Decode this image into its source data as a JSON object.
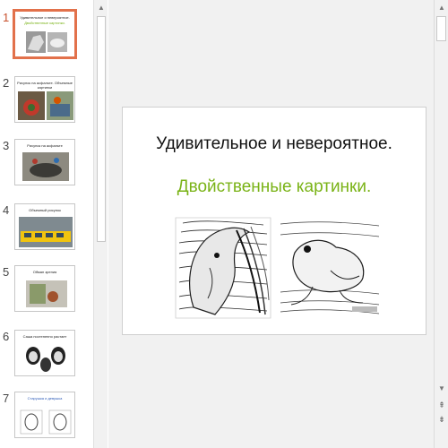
{
  "thumbnails": [
    {
      "number": "1",
      "title": "Удивительное и невероятное.",
      "subtitle": "Двойственные картинки."
    },
    {
      "number": "2",
      "title": "Рисунок на асфальте. Объемные картинки"
    },
    {
      "number": "3",
      "title": "Рисунок на асфальте"
    },
    {
      "number": "4",
      "title": "Объемный рисунок"
    },
    {
      "number": "5",
      "title": "Обман зрения"
    },
    {
      "number": "6",
      "title": "Саша постепенно растает"
    },
    {
      "number": "7",
      "title": "Старушка и девушка"
    }
  ],
  "slide": {
    "title": "Удивительное и невероятное.",
    "subtitle": "Двойственные картинки."
  },
  "icons": {
    "scroll_up": "up-arrow-icon",
    "scroll_down": "down-arrow-icon",
    "prev_slide": "double-up-arrow-icon",
    "next_slide": "double-down-arrow-icon"
  },
  "colors": {
    "active_thumb_border": "#e2714b",
    "active_number": "#c8512d",
    "subtitle_green": "#7ab317"
  }
}
